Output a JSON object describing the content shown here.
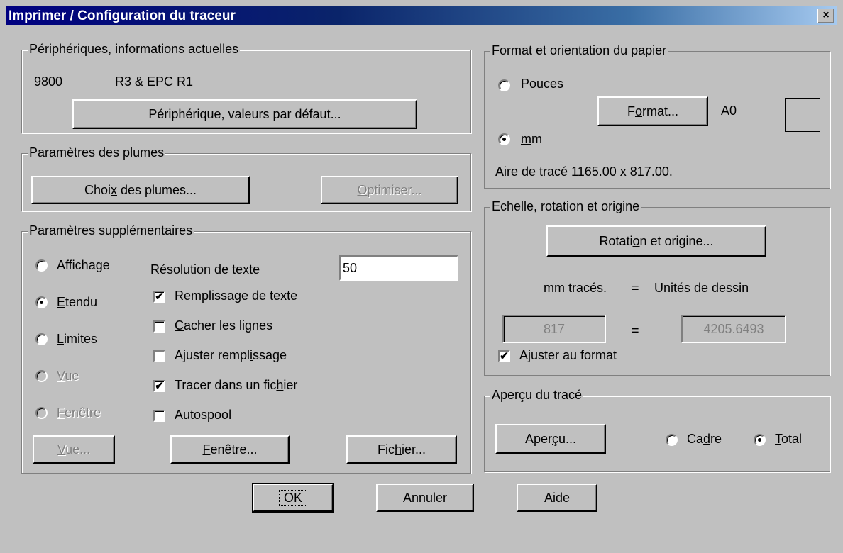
{
  "window": {
    "title": "Imprimer / Configuration du traceur",
    "close_glyph": "×"
  },
  "device": {
    "legend": "Périphériques, informations actuelles",
    "model": "9800",
    "version": "R3 & EPC R1",
    "defaults_button": "Périphérique, valeurs par défaut..."
  },
  "pens": {
    "legend": "Paramètres des plumes",
    "choose_pre": "Choi",
    "choose_u": "x",
    "choose_post": " des plumes...",
    "optimize_pre": "",
    "optimize_u": "O",
    "optimize_post": "ptimiser..."
  },
  "additional": {
    "legend": "Paramètres supplémentaires",
    "radios": [
      {
        "pre": "",
        "u": "",
        "post": "Affichage",
        "selected": false,
        "disabled": false
      },
      {
        "pre": "",
        "u": "E",
        "post": "tendu",
        "selected": true,
        "disabled": false
      },
      {
        "pre": "",
        "u": "L",
        "post": "imites",
        "selected": false,
        "disabled": false
      },
      {
        "pre": "",
        "u": "V",
        "post": "ue",
        "selected": false,
        "disabled": true
      },
      {
        "pre": "",
        "u": "F",
        "post": "enêtre",
        "selected": false,
        "disabled": true
      }
    ],
    "text_resolution_label": "Résolution de texte",
    "text_resolution_value": "50",
    "checkboxes": [
      {
        "pre": "",
        "u": "",
        "post": "Remplissage de texte",
        "checked": true
      },
      {
        "pre": "",
        "u": "C",
        "post": "acher les lignes",
        "checked": false
      },
      {
        "pre": "Ajuster rempl",
        "u": "i",
        "post": "ssage",
        "checked": false
      },
      {
        "pre": "Tracer dans un fic",
        "u": "h",
        "post": "ier",
        "checked": true
      },
      {
        "pre": "Auto",
        "u": "s",
        "post": "pool",
        "checked": false
      }
    ],
    "view_button_u": "V",
    "view_button_post": "ue...",
    "window_button_u": "F",
    "window_button_post": "enêtre...",
    "file_button_pre": "Fic",
    "file_button_u": "h",
    "file_button_post": "ier..."
  },
  "paper": {
    "legend": "Format et orientation du papier",
    "inches_pre": "Po",
    "inches_u": "u",
    "inches_post": "ces",
    "mm_u": "m",
    "mm_post": "m",
    "format_pre": "F",
    "format_u": "o",
    "format_post": "rmat...",
    "format_value": "A0",
    "area": "Aire de tracé 1165.00 x 817.00.",
    "selected": "mm"
  },
  "scale": {
    "legend": "Echelle, rotation et origine",
    "rotation_pre": "Rotati",
    "rotation_u": "o",
    "rotation_post": "n et origine...",
    "mm_label": "mm tracés.",
    "equals": "=",
    "units_label": "Unités de dessin",
    "mm_value": "817",
    "units_value": "4205.6493",
    "fit_label": "Ajuster au format",
    "fit_checked": true
  },
  "preview": {
    "legend": "Aperçu du tracé",
    "button_pre": "Aper",
    "button_u": "ç",
    "button_post": "u...",
    "frame_pre": "Ca",
    "frame_u": "d",
    "frame_post": "re",
    "total_u": "T",
    "total_post": "otal",
    "selected": "Total"
  },
  "footer": {
    "ok_u": "O",
    "ok_post": "K",
    "cancel": "Annuler",
    "help_u": "A",
    "help_post": "ide"
  },
  "check_glyph": "✔"
}
